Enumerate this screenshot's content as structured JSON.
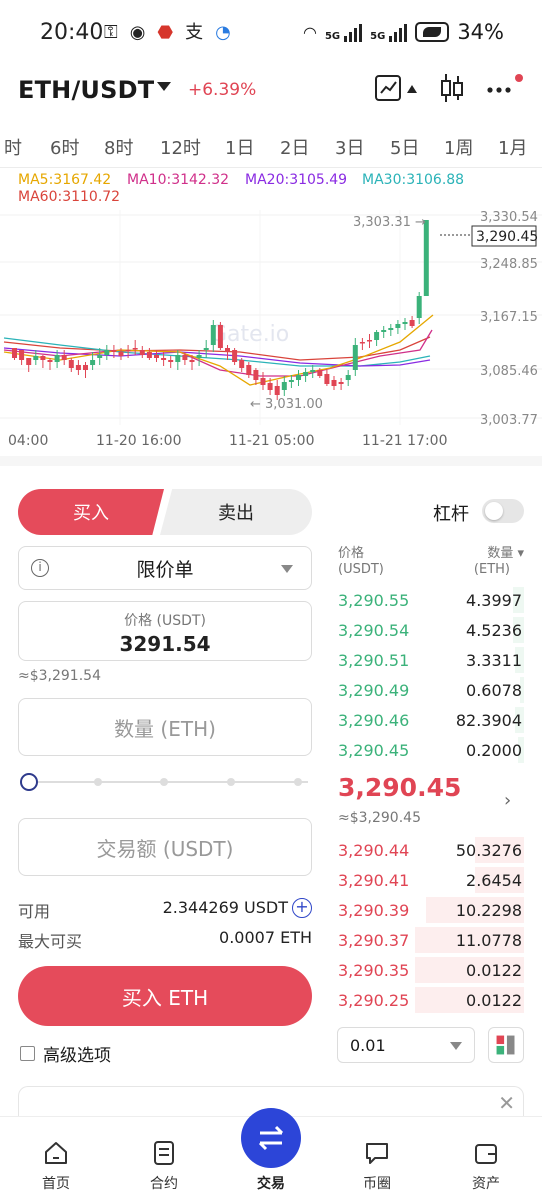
{
  "status_bar": {
    "time": "20:40",
    "battery": "34%",
    "network": "5G"
  },
  "header": {
    "pair": "ETH/USDT",
    "change": "+6.39%",
    "change_color": "#e04554"
  },
  "timeframes": [
    "时",
    "6时",
    "8时",
    "12时",
    "1日",
    "2日",
    "3日",
    "5日",
    "1周",
    "1月"
  ],
  "ma_legend": {
    "ma5": "MA5:3167.42",
    "ma10": "MA10:3142.32",
    "ma20": "MA20:3105.49",
    "ma30": "MA30:3106.88",
    "ma60": "MA60:3110.72"
  },
  "chart": {
    "price_axis": [
      "3,330.54",
      "3,248.85",
      "3,167.15",
      "3,085.46",
      "3,003.77"
    ],
    "last_price_tag": "3,290.45",
    "high_marker": "3,303.31 →",
    "low_marker": "← 3,031.00",
    "time_axis": [
      "04:00",
      "11-20 16:00",
      "11-21 05:00",
      "11-21 17:00"
    ],
    "watermark": "Gate.io",
    "up_color": "#3bb27a",
    "down_color": "#e04554"
  },
  "order_form": {
    "buy_tab": "买入",
    "sell_tab": "卖出",
    "leverage_label": "杠杆",
    "order_type": "限价单",
    "price_label": "价格 (USDT)",
    "price_value": "3291.54",
    "price_approx": "≈$3,291.54",
    "quantity_placeholder": "数量 (ETH)",
    "amount_placeholder": "交易额 (USDT)",
    "available_label": "可用",
    "available_value": "2.344269 USDT",
    "max_buy_label": "最大可买",
    "max_buy_value": "0.0007 ETH",
    "buy_button": "买入 ETH",
    "advanced_label": "高级选项"
  },
  "order_book": {
    "price_header": "价格",
    "price_unit": "(USDT)",
    "qty_header": "数量 ▾",
    "qty_unit": "(ETH)",
    "asks": [
      {
        "price": "3,290.55",
        "qty": "4.3997",
        "depth": 0.06
      },
      {
        "price": "3,290.54",
        "qty": "4.5236",
        "depth": 0.06
      },
      {
        "price": "3,290.51",
        "qty": "3.3311",
        "depth": 0.05
      },
      {
        "price": "3,290.49",
        "qty": "0.6078",
        "depth": 0.02
      },
      {
        "price": "3,290.46",
        "qty": "82.3904",
        "depth": 0.05
      },
      {
        "price": "3,290.45",
        "qty": "0.2000",
        "depth": 0.03
      }
    ],
    "last_price": "3,290.45",
    "last_price_usd": "≈$3,290.45",
    "bids": [
      {
        "price": "3,290.44",
        "qty": "50.3276",
        "depth": 0.26
      },
      {
        "price": "3,290.41",
        "qty": "2.6454",
        "depth": 0.26
      },
      {
        "price": "3,290.39",
        "qty": "10.2298",
        "depth": 0.52
      },
      {
        "price": "3,290.37",
        "qty": "11.0778",
        "depth": 0.58
      },
      {
        "price": "3,290.35",
        "qty": "0.0122",
        "depth": 0.58
      },
      {
        "price": "3,290.25",
        "qty": "0.0122",
        "depth": 0.58
      }
    ],
    "depth_value": "0.01"
  },
  "bottom_nav": {
    "home": "首页",
    "futures": "合约",
    "trade": "交易",
    "community": "币圈",
    "assets": "资产"
  }
}
